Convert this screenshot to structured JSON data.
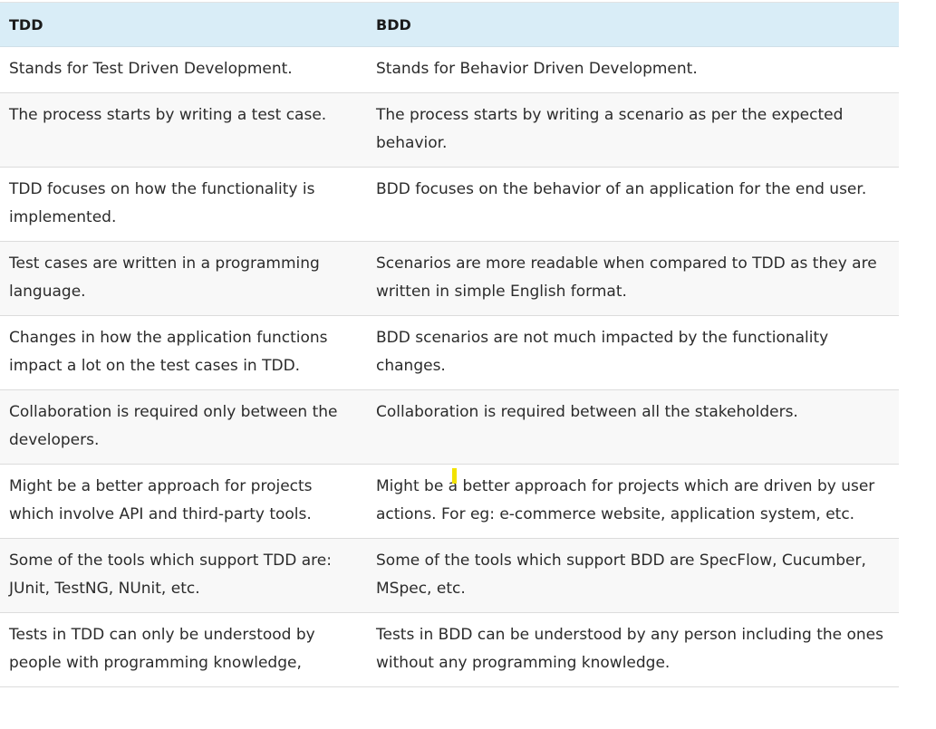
{
  "table": {
    "headers": [
      "TDD",
      "BDD"
    ],
    "rows": [
      [
        "Stands for Test Driven Development.",
        "Stands for Behavior Driven Development."
      ],
      [
        "The process starts by writing a test case.",
        "The process starts by writing a scenario as per the expected behavior."
      ],
      [
        "TDD focuses on how the functionality is implemented.",
        "BDD focuses on the behavior of an application for the end user."
      ],
      [
        "Test cases are written in a programming language.",
        "Scenarios are more readable when compared to TDD as they are written in simple English format."
      ],
      [
        "Changes in how the application functions impact a lot on the test cases in TDD.",
        "BDD scenarios are not much impacted by the functionality changes."
      ],
      [
        "Collaboration is required only between the developers.",
        "Collaboration is required between all the stakeholders."
      ],
      [
        "Might be a better approach for projects which involve API and third-party tools.",
        "Might be a better approach for projects which are driven by user actions. For eg: e-commerce website, application system, etc."
      ],
      [
        "Some of the tools which support TDD are: JUnit, TestNG, NUnit, etc.",
        "Some of the tools which support BDD are SpecFlow, Cucumber, MSpec, etc."
      ],
      [
        "Tests in TDD can only be understood by people with programming knowledge,",
        "Tests in BDD can be understood by any person including the ones without any programming knowledge."
      ]
    ]
  },
  "colors": {
    "header_bg": "#d9edf7",
    "stripe_bg": "#f8f8f8",
    "cursor_mark": "#f2e200"
  }
}
